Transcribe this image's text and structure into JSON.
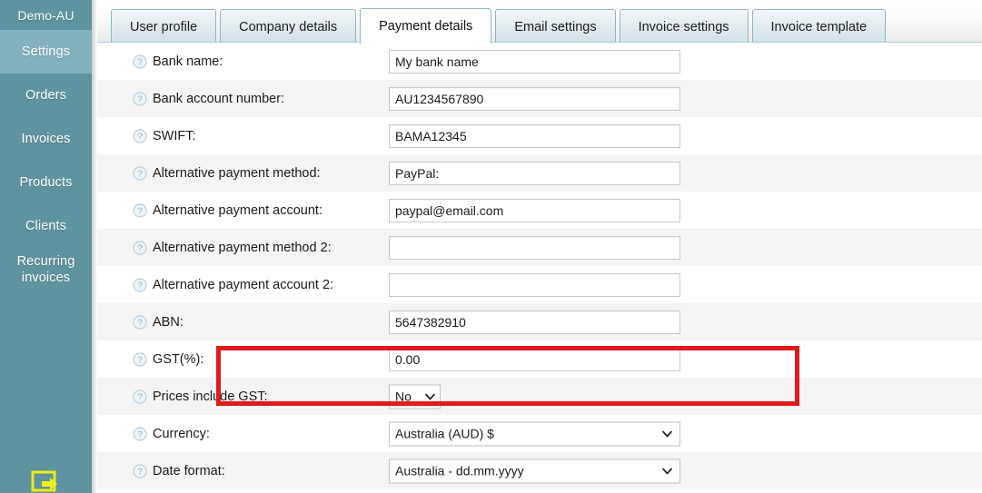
{
  "sidebar": {
    "brand": "Demo-AU",
    "items": [
      {
        "label": "Settings",
        "active": true
      },
      {
        "label": "Orders",
        "active": false
      },
      {
        "label": "Invoices",
        "active": false
      },
      {
        "label": "Products",
        "active": false
      },
      {
        "label": "Clients",
        "active": false
      },
      {
        "label": "Recurring invoices",
        "active": false
      }
    ],
    "bottom_icon": "export-image-icon",
    "bg_color": "#5f939f",
    "active_bg_color": "#83b1bd",
    "bottom_icon_color": "#ecec19"
  },
  "tabs": [
    {
      "label": "User profile",
      "active": false
    },
    {
      "label": "Company details",
      "active": false
    },
    {
      "label": "Payment details",
      "active": true
    },
    {
      "label": "Email settings",
      "active": false
    },
    {
      "label": "Invoice settings",
      "active": false
    },
    {
      "label": "Invoice template",
      "active": false
    }
  ],
  "form": {
    "help_icon": "help-question-icon",
    "caret_icon": "chevron-down-icon",
    "rows": [
      {
        "label": "Bank name:",
        "type": "text",
        "value": "My bank name",
        "placeholder": "",
        "striped": false,
        "name": "bank-name"
      },
      {
        "label": "Bank account number:",
        "type": "text",
        "value": "AU1234567890",
        "placeholder": "",
        "striped": true,
        "name": "bank-account-number"
      },
      {
        "label": "SWIFT:",
        "type": "text",
        "value": "BAMA12345",
        "placeholder": "",
        "striped": false,
        "name": "swift"
      },
      {
        "label": "Alternative payment method:",
        "type": "text",
        "value": "PayPal:",
        "placeholder": "",
        "striped": true,
        "name": "alt-payment-method"
      },
      {
        "label": "Alternative payment account:",
        "type": "text",
        "value": "paypal@email.com",
        "placeholder": "",
        "striped": false,
        "name": "alt-payment-account"
      },
      {
        "label": "Alternative payment method 2:",
        "type": "text",
        "value": "",
        "placeholder": "",
        "striped": true,
        "name": "alt-payment-method-2"
      },
      {
        "label": "Alternative payment account 2:",
        "type": "text",
        "value": "",
        "placeholder": "",
        "striped": false,
        "name": "alt-payment-account-2"
      },
      {
        "label": "ABN:",
        "type": "text",
        "value": "5647382910",
        "placeholder": "",
        "striped": true,
        "name": "abn"
      },
      {
        "label": "GST(%):",
        "type": "text",
        "value": "0.00",
        "placeholder": "",
        "striped": false,
        "name": "gst-percent"
      },
      {
        "label": "Prices include GST:",
        "type": "select-narrow",
        "value": "No",
        "placeholder": "",
        "striped": true,
        "name": "prices-include-gst"
      },
      {
        "label": "Currency:",
        "type": "select",
        "value": "Australia (AUD) $",
        "placeholder": "",
        "striped": false,
        "name": "currency"
      },
      {
        "label": "Date format:",
        "type": "select",
        "value": "Australia - dd.mm.yyyy",
        "placeholder": "",
        "striped": true,
        "name": "date-format"
      }
    ]
  },
  "annotation": {
    "type": "highlight-rectangle",
    "target_row": "GST(%):",
    "color": "#e01b1b"
  }
}
